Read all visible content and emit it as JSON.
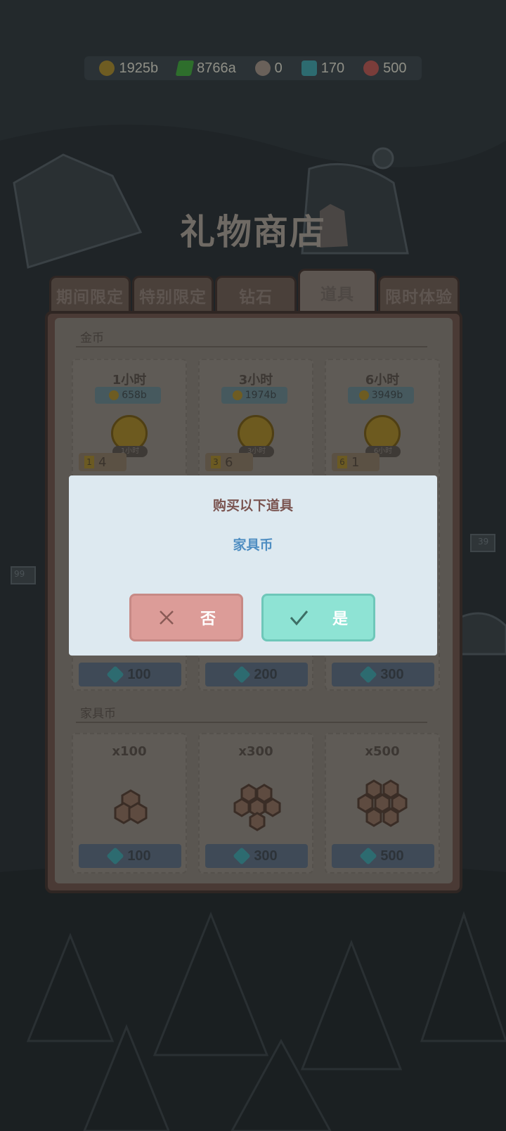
{
  "currencies": [
    {
      "name": "gold-coin-icon",
      "value": "1925b",
      "color": "#6e5c22"
    },
    {
      "name": "energy-icon",
      "value": "8766a",
      "color": "#2e6e2c"
    },
    {
      "name": "cat-food-icon",
      "value": "0",
      "color": "#6a615a"
    },
    {
      "name": "diamond-icon",
      "value": "170",
      "color": "#2d6b70"
    },
    {
      "name": "candy-icon",
      "value": "500",
      "color": "#7a3d3a"
    }
  ],
  "shop": {
    "title": "礼物商店",
    "tabs": [
      {
        "label": "期间限定",
        "active": false
      },
      {
        "label": "特别限定",
        "active": false
      },
      {
        "label": "钻石",
        "active": false
      },
      {
        "label": "道具",
        "active": true
      },
      {
        "label": "限时体验",
        "active": false
      }
    ],
    "gold_section": {
      "label": "金币",
      "cards": [
        {
          "title": "1小时",
          "price": "658b",
          "badge": "1小时",
          "count": "4",
          "tag": "1",
          "cost": "100"
        },
        {
          "title": "3小时",
          "price": "1974b",
          "badge": "3小时",
          "count": "6",
          "tag": "3",
          "cost": "200"
        },
        {
          "title": "6小时",
          "price": "3949b",
          "badge": "6小时",
          "count": "1",
          "tag": "6",
          "cost": "300"
        }
      ]
    },
    "furniture_section": {
      "label": "家具币",
      "cards": [
        {
          "title": "x100",
          "cost": "100"
        },
        {
          "title": "x300",
          "cost": "300"
        },
        {
          "title": "x500",
          "cost": "500"
        }
      ]
    }
  },
  "dialog": {
    "title": "购买以下道具",
    "item": "家具币",
    "no_label": "否",
    "yes_label": "是"
  },
  "decor": {
    "sign_left": "99",
    "sign_right": "39"
  }
}
